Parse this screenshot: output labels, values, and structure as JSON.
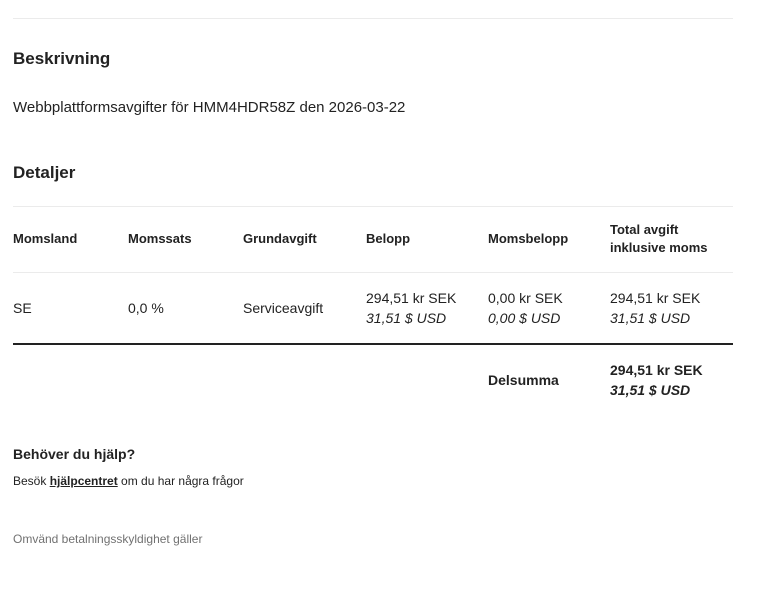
{
  "description_section": {
    "heading": "Beskrivning",
    "text": "Webbplattformsavgifter för HMM4HDR58Z den 2026-03-22"
  },
  "details_section": {
    "heading": "Detaljer",
    "columns": [
      "Momsland",
      "Momssats",
      "Grundavgift",
      "Belopp",
      "Momsbelopp",
      "Total avgift inklusive moms"
    ],
    "rows": [
      {
        "country": "SE",
        "rate": "0,0 %",
        "base_fee": "Serviceavgift",
        "amount_sek": "294,51 kr SEK",
        "amount_usd": "31,51 $ USD",
        "vat_sek": "0,00 kr SEK",
        "vat_usd": "0,00 $ USD",
        "total_sek": "294,51 kr SEK",
        "total_usd": "31,51 $ USD"
      }
    ],
    "subtotal": {
      "label": "Delsumma",
      "sek": "294,51 kr SEK",
      "usd": "31,51 $ USD"
    }
  },
  "help": {
    "title": "Behöver du hjälp?",
    "prefix": "Besök ",
    "link_text": "hjälpcentret",
    "suffix": " om du har några frågor"
  },
  "footer_note": "Omvänd betalningsskyldighet gäller"
}
